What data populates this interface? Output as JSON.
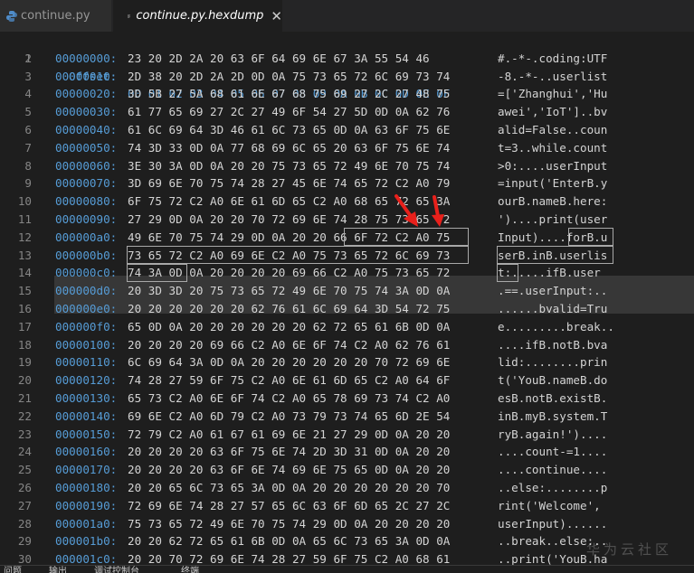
{
  "tabs": [
    {
      "label": "continue.py",
      "active": false,
      "icon": "python-icon"
    },
    {
      "label": "continue.py.hexdump",
      "active": true,
      "icon": "lines-icon",
      "close": "✕"
    }
  ],
  "header": {
    "line": "1",
    "offset_label": "Offset:",
    "columns": "00 01 02 03 04 05 06 07 08 09 0A 0B 0C 0D 0E 0F"
  },
  "rows": [
    {
      "ln": "2",
      "addr": "00000000:",
      "hex": "23 20 2D 2A 20 63 6F 64 69 6E 67 3A 55 54 46",
      "ascii": "#.-*-.coding:UTF"
    },
    {
      "ln": "3",
      "addr": "00000010:",
      "hex": "2D 38 20 2D 2A 2D 0D 0A 75 73 65 72 6C 69 73 74",
      "ascii": "-8.-*-..userlist"
    },
    {
      "ln": "4",
      "addr": "00000020:",
      "hex": "3D 5B 27 5A 68 61 6E 67 68 75 69 27 2C 27 48 75",
      "ascii": "=['Zhanghui','Hu"
    },
    {
      "ln": "5",
      "addr": "00000030:",
      "hex": "61 77 65 69 27 2C 27 49 6F 54 27 5D 0D 0A 62 76",
      "ascii": "awei','IoT']..bv"
    },
    {
      "ln": "6",
      "addr": "00000040:",
      "hex": "61 6C 69 64 3D 46 61 6C 73 65 0D 0A 63 6F 75 6E",
      "ascii": "alid=False..coun"
    },
    {
      "ln": "7",
      "addr": "00000050:",
      "hex": "74 3D 33 0D 0A 77 68 69 6C 65 20 63 6F 75 6E 74",
      "ascii": "t=3..while.count"
    },
    {
      "ln": "8",
      "addr": "00000060:",
      "hex": "3E 30 3A 0D 0A 20 20 75 73 65 72 49 6E 70 75 74",
      "ascii": ">0:....userInput"
    },
    {
      "ln": "9",
      "addr": "00000070:",
      "hex": "3D 69 6E 70 75 74 28 27 45 6E 74 65 72 C2 A0 79",
      "ascii": "=input('EnterB.y"
    },
    {
      "ln": "10",
      "addr": "00000080:",
      "hex": "6F 75 72 C2 A0 6E 61 6D 65 C2 A0 68 65 72 65 3A",
      "ascii": "ourB.nameB.here:"
    },
    {
      "ln": "11",
      "addr": "00000090:",
      "hex": "27 29 0D 0A 20 20 70 72 69 6E 74 28 75 73 65 72",
      "ascii": "')....print(user"
    },
    {
      "ln": "12",
      "addr": "000000a0:",
      "hex": "49 6E 70 75 74 29 0D 0A 20 20 66 6F 72 C2 A0 75",
      "ascii": "Input)....forB.u"
    },
    {
      "ln": "13",
      "addr": "000000b0:",
      "hex": "73 65 72 C2 A0 69 6E C2 A0 75 73 65 72 6C 69 73",
      "ascii": "serB.inB.userlis"
    },
    {
      "ln": "14",
      "addr": "000000c0:",
      "hex": "74 3A 0D 0A 20 20 20 20 69 66 C2 A0 75 73 65 72",
      "ascii": "t:.....ifB.user"
    },
    {
      "ln": "15",
      "addr": "000000d0:",
      "hex": "20 3D 3D 20 75 73 65 72 49 6E 70 75 74 3A 0D 0A",
      "ascii": ".==.userInput:.."
    },
    {
      "ln": "16",
      "addr": "000000e0:",
      "hex": "20 20 20 20 20 20 62 76 61 6C 69 64 3D 54 72 75",
      "ascii": "......bvalid=Tru"
    },
    {
      "ln": "17",
      "addr": "000000f0:",
      "hex": "65 0D 0A 20 20 20 20 20 20 62 72 65 61 6B 0D 0A",
      "ascii": "e.........break.."
    },
    {
      "ln": "18",
      "addr": "00000100:",
      "hex": "20 20 20 20 69 66 C2 A0 6E 6F 74 C2 A0 62 76 61",
      "ascii": "....ifB.notB.bva"
    },
    {
      "ln": "19",
      "addr": "00000110:",
      "hex": "6C 69 64 3A 0D 0A 20 20 20 20 20 20 70 72 69 6E",
      "ascii": "lid:........prin"
    },
    {
      "ln": "20",
      "addr": "00000120:",
      "hex": "74 28 27 59 6F 75 C2 A0 6E 61 6D 65 C2 A0 64 6F",
      "ascii": "t('YouB.nameB.do"
    },
    {
      "ln": "21",
      "addr": "00000130:",
      "hex": "65 73 C2 A0 6E 6F 74 C2 A0 65 78 69 73 74 C2 A0",
      "ascii": "esB.notB.existB."
    },
    {
      "ln": "22",
      "addr": "00000140:",
      "hex": "69 6E C2 A0 6D 79 C2 A0 73 79 73 74 65 6D 2E 54",
      "ascii": "inB.myB.system.T"
    },
    {
      "ln": "23",
      "addr": "00000150:",
      "hex": "72 79 C2 A0 61 67 61 69 6E 21 27 29 0D 0A 20 20",
      "ascii": "ryB.again!')...."
    },
    {
      "ln": "24",
      "addr": "00000160:",
      "hex": "20 20 20 20 63 6F 75 6E 74 2D 3D 31 0D 0A 20 20",
      "ascii": "....count-=1...."
    },
    {
      "ln": "25",
      "addr": "00000170:",
      "hex": "20 20 20 20 63 6F 6E 74 69 6E 75 65 0D 0A 20 20",
      "ascii": "....continue...."
    },
    {
      "ln": "26",
      "addr": "00000180:",
      "hex": "20 20 65 6C 73 65 3A 0D 0A 20 20 20 20 20 20 70",
      "ascii": "..else:........p"
    },
    {
      "ln": "27",
      "addr": "00000190:",
      "hex": "72 69 6E 74 28 27 57 65 6C 63 6F 6D 65 2C 27 2C",
      "ascii": "rint('Welcome',"
    },
    {
      "ln": "28",
      "addr": "000001a0:",
      "hex": "75 73 65 72 49 6E 70 75 74 29 0D 0A 20 20 20 20",
      "ascii": "userInput)......"
    },
    {
      "ln": "29",
      "addr": "000001b0:",
      "hex": "20 20 62 72 65 61 6B 0D 0A 65 6C 73 65 3A 0D 0A",
      "ascii": "..break..else:.."
    },
    {
      "ln": "30",
      "addr": "000001c0:",
      "hex": "20 20 70 72 69 6E 74 28 27 59 6F 75 C2 A0 68 61",
      "ascii": "..print('YouB.ha"
    }
  ],
  "status": {
    "items": [
      "问题",
      "输出",
      "调试控制台",
      "终端"
    ]
  },
  "watermark": "华为云社区",
  "colors": {
    "background": "#1e1e1e",
    "address": "#569cd6",
    "text": "#d4d4d4",
    "line_number": "#858585",
    "arrow": "#e8201b"
  }
}
